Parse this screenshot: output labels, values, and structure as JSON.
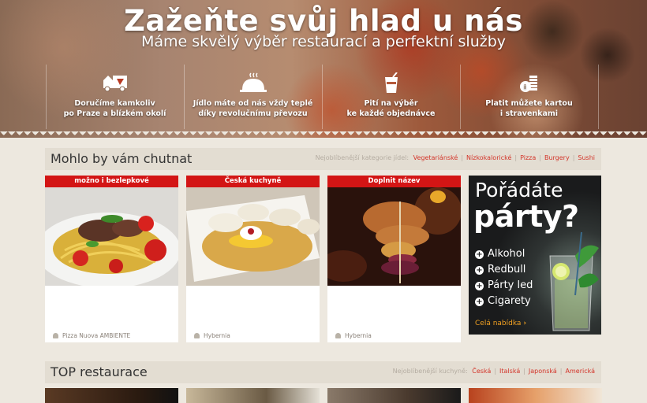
{
  "hero": {
    "title": "Zažeňte svůj hlad u nás",
    "subtitle": "Máme skvělý výběr restaurací a perfektní služby",
    "features": [
      {
        "icon": "delivery-truck-icon",
        "line1": "Doručíme kamkoliv",
        "line2": "po Praze a blízkém okolí"
      },
      {
        "icon": "food-cloche-icon",
        "line1": "Jídlo máte od nás vždy teplé",
        "line2": "díky revolučnímu převozu"
      },
      {
        "icon": "drink-cup-icon",
        "line1": "Pití na výběr",
        "line2": "ke každé objednávce"
      },
      {
        "icon": "coins-payment-icon",
        "line1": "Platit můžete kartou",
        "line2": "i stravenkami"
      }
    ]
  },
  "section1": {
    "title": "Mohlo by vám chutnat",
    "cats_label": "Nejoblíbenější kategorie jídel:",
    "cats": [
      "Vegetariánské",
      "Nízkokalorické",
      "Pizza",
      "Burgery",
      "Sushi"
    ]
  },
  "cards": [
    {
      "title": "možno i bezlepkové",
      "restaurant": "Pizza Nuova AMBIENTE"
    },
    {
      "title": "Česká kuchyně",
      "restaurant": "Hybernia"
    },
    {
      "title": "Doplnit název",
      "restaurant": "Hybernia"
    }
  ],
  "promo": {
    "line1": "Pořádáte",
    "line2": "párty?",
    "items": [
      "Alkohol",
      "Redbull",
      "Párty led",
      "Cigarety"
    ],
    "more": "Celá nabídka"
  },
  "section2": {
    "title": "TOP restaurace",
    "cats_label": "Nejoblíbenější kuchyně:",
    "cats": [
      "Česká",
      "Italská",
      "Japonská",
      "Americká"
    ]
  },
  "colors": {
    "accent_red": "#d31515",
    "link_red": "#d3352a",
    "promo_orange": "#f0a022"
  }
}
